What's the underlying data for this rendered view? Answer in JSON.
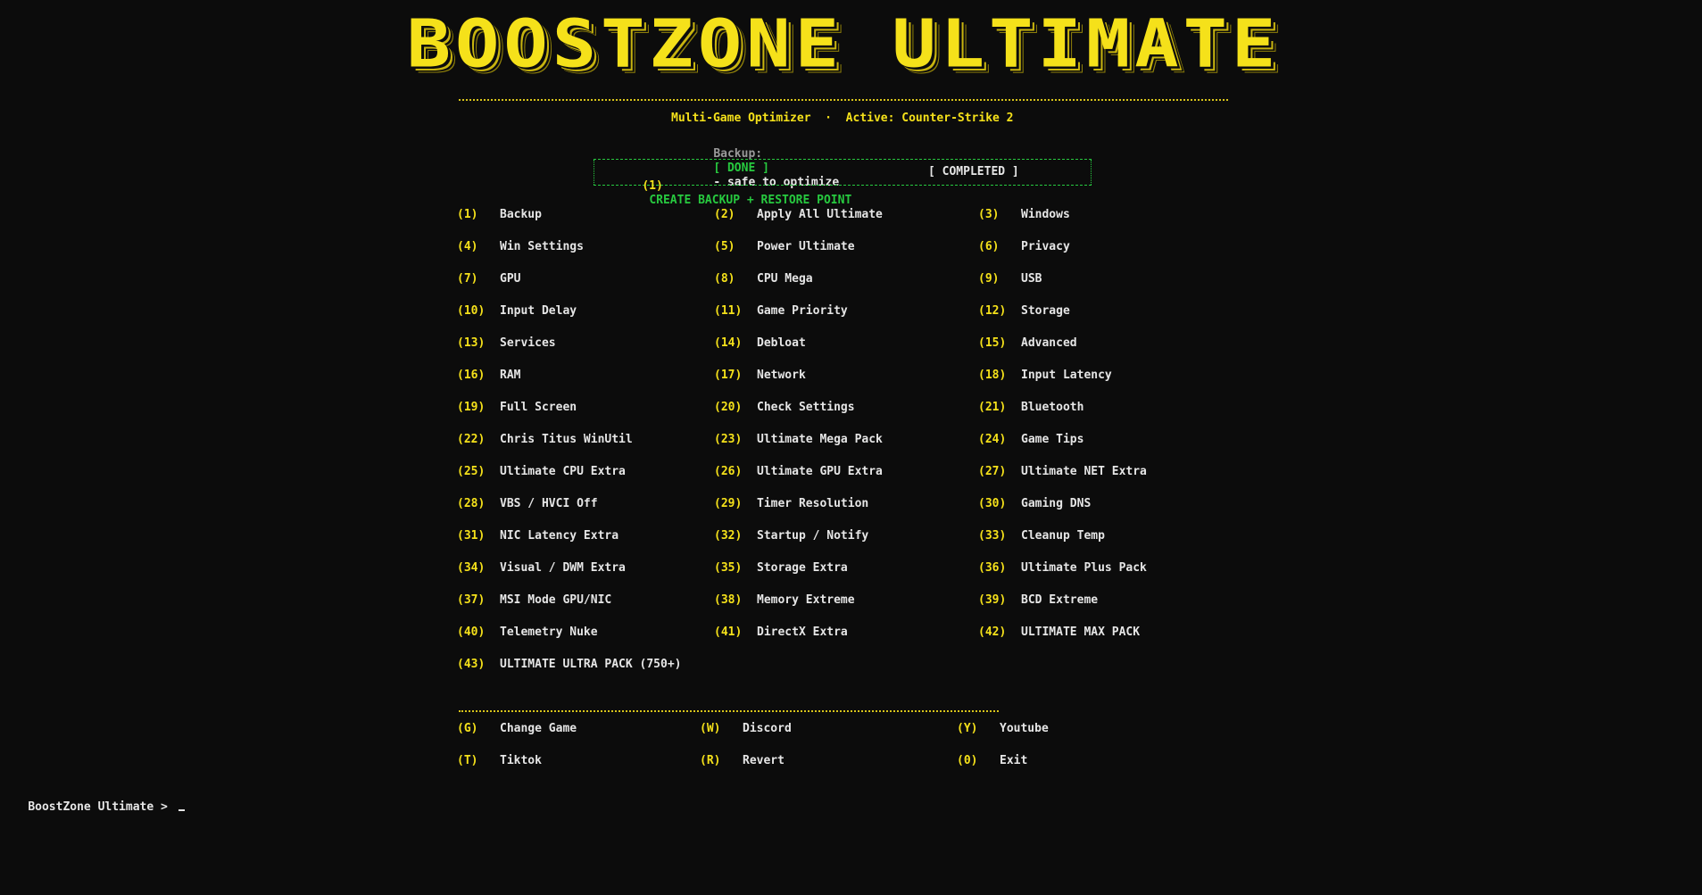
{
  "banner": {
    "title": "BOOSTZONE ULTIMATE",
    "color": "#f5e11a"
  },
  "header": {
    "subtitle": "Multi-Game Optimizer  ·  Active: Counter-Strike 2",
    "backup_label": "Backup:",
    "backup_status": "[ DONE ]",
    "backup_note": "- safe to optimize"
  },
  "status_box": {
    "key": "(1)",
    "text": "CREATE BACKUP + RESTORE POINT",
    "status": "[ COMPLETED ]"
  },
  "menu": [
    {
      "key": "(1)",
      "label": "Backup"
    },
    {
      "key": "(2)",
      "label": "Apply All Ultimate"
    },
    {
      "key": "(3)",
      "label": "Windows"
    },
    {
      "key": "(4)",
      "label": "Win Settings"
    },
    {
      "key": "(5)",
      "label": "Power Ultimate"
    },
    {
      "key": "(6)",
      "label": "Privacy"
    },
    {
      "key": "(7)",
      "label": "GPU"
    },
    {
      "key": "(8)",
      "label": "CPU Mega"
    },
    {
      "key": "(9)",
      "label": "USB"
    },
    {
      "key": "(10)",
      "label": "Input Delay"
    },
    {
      "key": "(11)",
      "label": "Game Priority"
    },
    {
      "key": "(12)",
      "label": "Storage"
    },
    {
      "key": "(13)",
      "label": "Services"
    },
    {
      "key": "(14)",
      "label": "Debloat"
    },
    {
      "key": "(15)",
      "label": "Advanced"
    },
    {
      "key": "(16)",
      "label": "RAM"
    },
    {
      "key": "(17)",
      "label": "Network"
    },
    {
      "key": "(18)",
      "label": "Input Latency"
    },
    {
      "key": "(19)",
      "label": "Full Screen"
    },
    {
      "key": "(20)",
      "label": "Check Settings"
    },
    {
      "key": "(21)",
      "label": "Bluetooth"
    },
    {
      "key": "(22)",
      "label": "Chris Titus WinUtil"
    },
    {
      "key": "(23)",
      "label": "Ultimate Mega Pack"
    },
    {
      "key": "(24)",
      "label": "Game Tips"
    },
    {
      "key": "(25)",
      "label": "Ultimate CPU Extra"
    },
    {
      "key": "(26)",
      "label": "Ultimate GPU Extra"
    },
    {
      "key": "(27)",
      "label": "Ultimate NET Extra"
    },
    {
      "key": "(28)",
      "label": "VBS / HVCI Off"
    },
    {
      "key": "(29)",
      "label": "Timer Resolution"
    },
    {
      "key": "(30)",
      "label": "Gaming DNS"
    },
    {
      "key": "(31)",
      "label": "NIC Latency Extra"
    },
    {
      "key": "(32)",
      "label": "Startup / Notify"
    },
    {
      "key": "(33)",
      "label": "Cleanup Temp"
    },
    {
      "key": "(34)",
      "label": "Visual / DWM Extra"
    },
    {
      "key": "(35)",
      "label": "Storage Extra"
    },
    {
      "key": "(36)",
      "label": "Ultimate Plus Pack"
    },
    {
      "key": "(37)",
      "label": "MSI Mode GPU/NIC"
    },
    {
      "key": "(38)",
      "label": "Memory Extreme"
    },
    {
      "key": "(39)",
      "label": "BCD Extreme"
    },
    {
      "key": "(40)",
      "label": "Telemetry Nuke"
    },
    {
      "key": "(41)",
      "label": "DirectX Extra"
    },
    {
      "key": "(42)",
      "label": "ULTIMATE MAX PACK"
    },
    {
      "key": "(43)",
      "label": "ULTIMATE ULTRA PACK (750+)"
    }
  ],
  "footer_menu": [
    {
      "key": "(G)",
      "label": "Change Game"
    },
    {
      "key": "(W)",
      "label": "Discord"
    },
    {
      "key": "(Y)",
      "label": "Youtube"
    },
    {
      "key": "(T)",
      "label": "Tiktok"
    },
    {
      "key": "(R)",
      "label": "Revert"
    },
    {
      "key": "(0)",
      "label": "Exit"
    }
  ],
  "prompt": {
    "text": "BoostZone Ultimate > "
  }
}
